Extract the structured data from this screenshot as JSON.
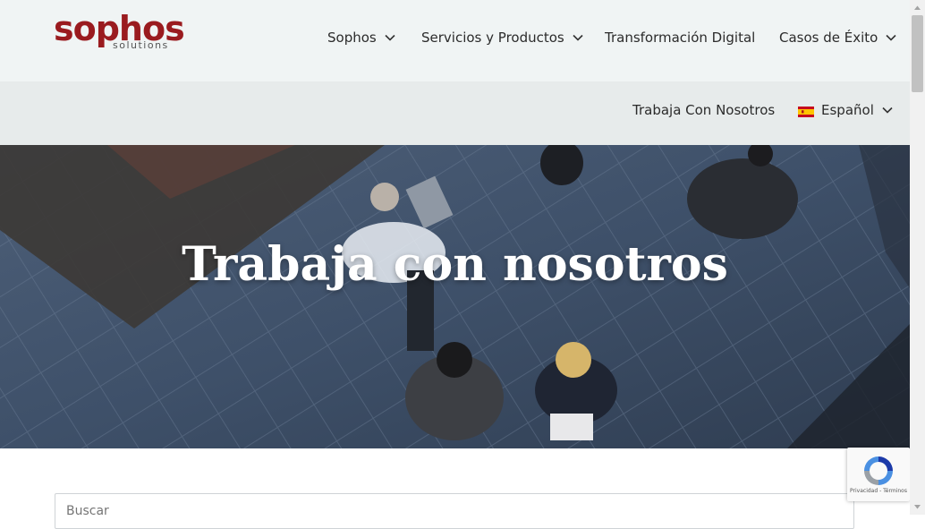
{
  "logo": {
    "main": "sophos",
    "sub": "solutions"
  },
  "nav": {
    "primary": [
      {
        "label": "Sophos",
        "has_dropdown": true
      },
      {
        "label": "Servicios y Productos",
        "has_dropdown": true
      },
      {
        "label": "Transformación Digital",
        "has_dropdown": false
      },
      {
        "label": "Casos de Éxito",
        "has_dropdown": true
      }
    ],
    "secondary": {
      "careers": "Trabaja Con Nosotros",
      "language": "Español",
      "language_flag": "spain-flag-icon"
    }
  },
  "hero": {
    "title": "Trabaja con nosotros"
  },
  "search": {
    "placeholder": "Buscar"
  },
  "recaptcha": {
    "text": "Privacidad - Términos"
  },
  "colors": {
    "brand": "#9a1b1f",
    "header_bg": "#f0f4f4",
    "subheader_bg": "#e7ebeb"
  }
}
